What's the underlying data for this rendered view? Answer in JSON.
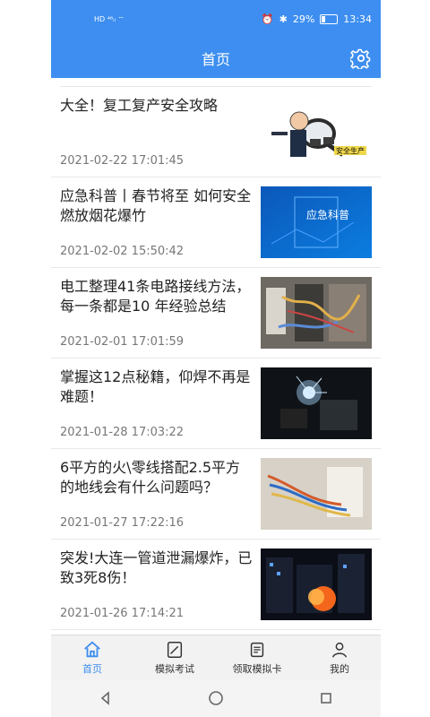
{
  "status": {
    "left": "HD ⁴⁶ᵢₗ ⌔",
    "battery": "29%",
    "time": "13:34"
  },
  "header": {
    "title": "首页"
  },
  "articles": [
    {
      "title": "大全！复工复产安全攻略",
      "date": "2021-02-22 17:01:45",
      "thumb": "安全生产"
    },
    {
      "title": "应急科普丨春节将至 如何安全燃放烟花爆竹",
      "date": "2021-02-02 15:50:42",
      "thumb": "应急科普"
    },
    {
      "title": "电工整理41条电路接线方法，每一条都是10 年经验总结",
      "date": "2021-02-01 17:01:59",
      "thumb": ""
    },
    {
      "title": "掌握这12点秘籍，仰焊不再是难题！",
      "date": "2021-01-28 17:03:22",
      "thumb": ""
    },
    {
      "title": "6平方的火\\零线搭配2.5平方的地线会有什么问题吗？",
      "date": "2021-01-27 17:22:16",
      "thumb": ""
    },
    {
      "title": "突发!大连一管道泄漏爆炸，已致3死8伤！",
      "date": "2021-01-26 17:14:21",
      "thumb": ""
    }
  ],
  "tabs": [
    {
      "label": "首页",
      "icon": "home-icon",
      "active": true
    },
    {
      "label": "模拟考试",
      "icon": "edit-icon",
      "active": false
    },
    {
      "label": "领取模拟卡",
      "icon": "card-icon",
      "active": false
    },
    {
      "label": "我的",
      "icon": "user-icon",
      "active": false
    }
  ],
  "colors": {
    "accent": "#3d8ef0"
  }
}
